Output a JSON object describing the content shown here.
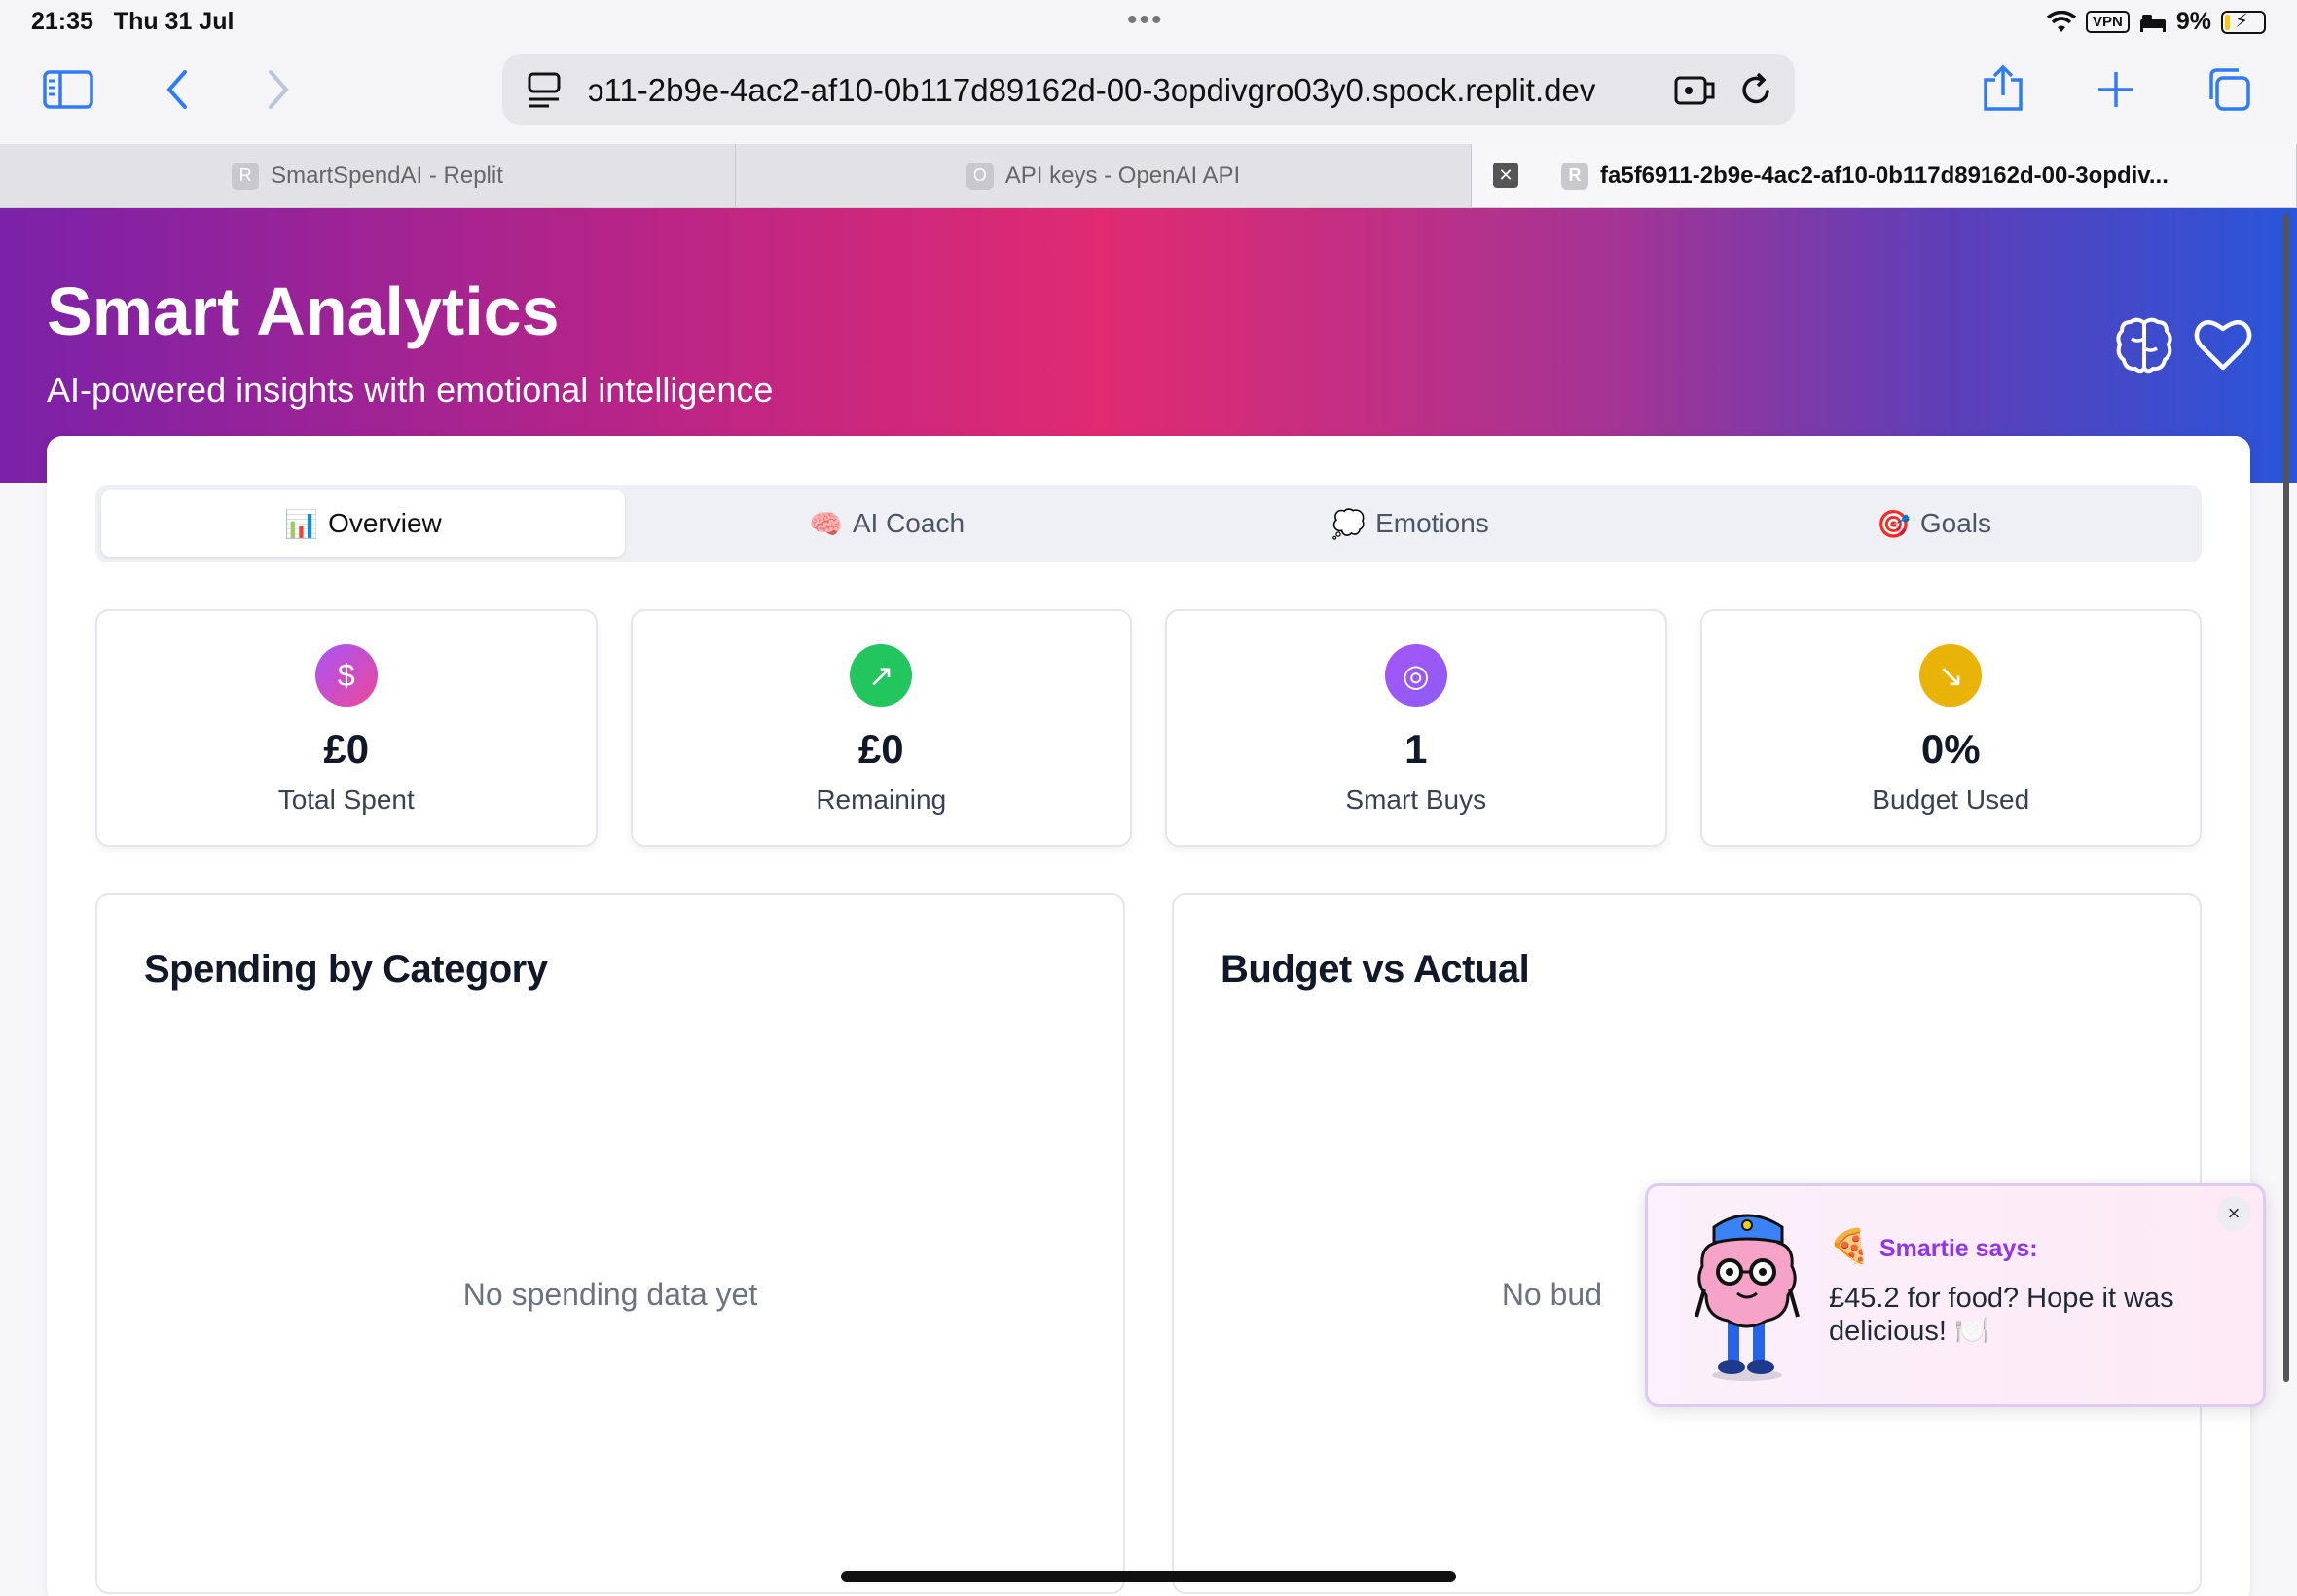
{
  "status_bar": {
    "time": "21:35",
    "date": "Thu 31 Jul",
    "vpn": "VPN",
    "battery": "9%"
  },
  "browser": {
    "url": "ɔ11-2b9e-4ac2-af10-0b117d89162d-00-3opdivgro03y0.spock.replit.dev",
    "tabs": [
      {
        "favicon": "R",
        "title": "SmartSpendAI - Replit"
      },
      {
        "favicon": "O",
        "title": "API keys - OpenAI API"
      },
      {
        "favicon": "R",
        "title": "fa5f6911-2b9e-4ac2-af10-0b117d89162d-00-3opdiv..."
      }
    ]
  },
  "hero": {
    "title": "Smart Analytics",
    "subtitle": "AI-powered insights with emotional intelligence"
  },
  "segments": [
    {
      "icon": "📊",
      "label": "Overview"
    },
    {
      "icon": "🧠",
      "label": "AI Coach"
    },
    {
      "icon": "💭",
      "label": "Emotions"
    },
    {
      "icon": "🎯",
      "label": "Goals"
    }
  ],
  "stats": [
    {
      "icon": "$",
      "value": "£0",
      "label": "Total Spent",
      "color": "#c044c9"
    },
    {
      "icon": "↗",
      "value": "£0",
      "label": "Remaining",
      "color": "#22c55e"
    },
    {
      "icon": "◎",
      "value": "1",
      "label": "Smart Buys",
      "color": "#a855f7"
    },
    {
      "icon": "↘",
      "value": "0%",
      "label": "Budget Used",
      "color": "#eab308"
    }
  ],
  "panels": {
    "spending": {
      "title": "Spending by Category",
      "empty": "No spending data yet"
    },
    "budget": {
      "title": "Budget vs Actual",
      "empty": "No bud"
    }
  },
  "toast": {
    "icon": "🍕",
    "title": "Smartie says:",
    "message": "£45.2 for food? Hope it was delicious! 🍽️",
    "close": "×"
  },
  "colors": {
    "accent": "#2f7cf6",
    "toast_title": "#9333ea"
  }
}
